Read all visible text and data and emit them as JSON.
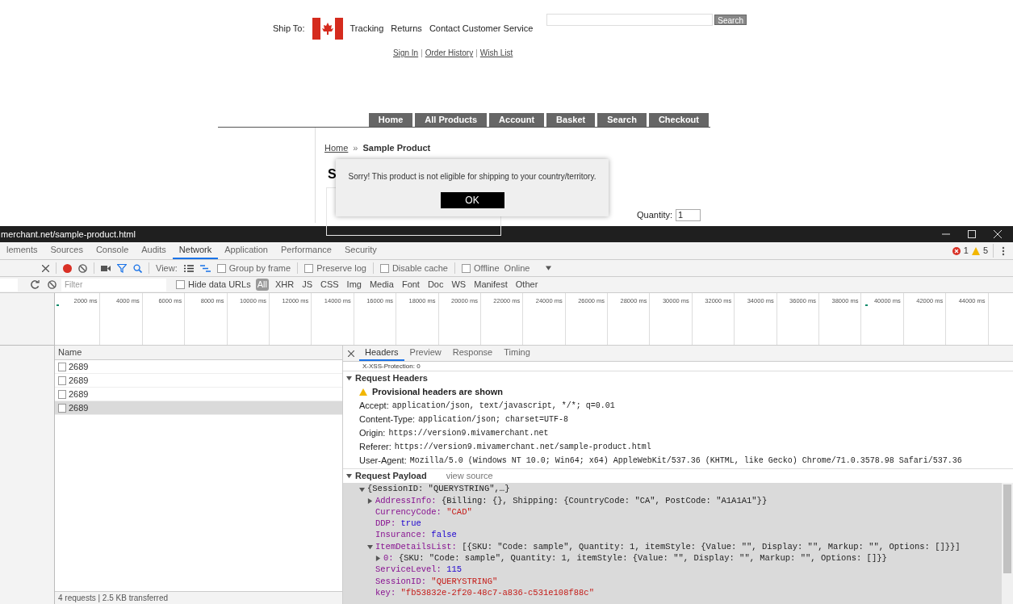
{
  "site": {
    "ship_to_label": "Ship To:",
    "top_links": [
      "Tracking",
      "Returns",
      "Contact Customer Service"
    ],
    "search_button": "Search",
    "account_links": [
      "Sign In",
      "Order History",
      "Wish List"
    ],
    "link_separator": "|",
    "nav": [
      "Home",
      "All Products",
      "Account",
      "Basket",
      "Search",
      "Checkout"
    ],
    "breadcrumb": {
      "link": "Home",
      "separator": "»",
      "current": "Sample Product"
    },
    "heading": "S",
    "quantity": {
      "label": "Quantity:",
      "value": "1"
    },
    "dialog": {
      "message": "Sorry! This product is not eligible for shipping to your country/territory.",
      "button": "OK"
    }
  },
  "devtools": {
    "url": "merchant.net/sample-product.html",
    "panel_tabs": [
      {
        "label": "lements",
        "selected": false
      },
      {
        "label": "Sources",
        "selected": false
      },
      {
        "label": "Console",
        "selected": false
      },
      {
        "label": "Audits",
        "selected": false
      },
      {
        "label": "Network",
        "selected": true
      },
      {
        "label": "Application",
        "selected": false
      },
      {
        "label": "Performance",
        "selected": false
      },
      {
        "label": "Security",
        "selected": false
      }
    ],
    "errors": "1",
    "warnings": "5",
    "toolbar": {
      "recording": true,
      "filter_active": true,
      "view_label": "View:",
      "options": [
        {
          "label": "Group by frame",
          "checked": false
        },
        {
          "label": "Preserve log",
          "checked": false
        },
        {
          "label": "Disable cache",
          "checked": false
        },
        {
          "label": "Offline",
          "checked": false
        }
      ],
      "throttle": "Online"
    },
    "filter_bar": {
      "placeholder": "Filter",
      "hide_data_urls": {
        "label": "Hide data URLs",
        "checked": false
      },
      "types": [
        {
          "label": "All",
          "selected": true
        },
        {
          "label": "XHR",
          "selected": false
        },
        {
          "label": "JS",
          "selected": false
        },
        {
          "label": "CSS",
          "selected": false
        },
        {
          "label": "Img",
          "selected": false
        },
        {
          "label": "Media",
          "selected": false
        },
        {
          "label": "Font",
          "selected": false
        },
        {
          "label": "Doc",
          "selected": false
        },
        {
          "label": "WS",
          "selected": false
        },
        {
          "label": "Manifest",
          "selected": false
        },
        {
          "label": "Other",
          "selected": false
        }
      ]
    },
    "timeline": {
      "ticks": [
        "2000 ms",
        "4000 ms",
        "6000 ms",
        "8000 ms",
        "10000 ms",
        "12000 ms",
        "14000 ms",
        "16000 ms",
        "18000 ms",
        "20000 ms",
        "22000 ms",
        "24000 ms",
        "26000 ms",
        "28000 ms",
        "30000 ms",
        "32000 ms",
        "34000 ms",
        "36000 ms",
        "38000 ms",
        "40000 ms",
        "42000 ms",
        "44000 ms"
      ]
    },
    "requests": {
      "column": "Name",
      "rows": [
        {
          "name": "2689",
          "selected": false
        },
        {
          "name": "2689",
          "selected": false
        },
        {
          "name": "2689",
          "selected": false
        },
        {
          "name": "2689",
          "selected": true
        }
      ],
      "summary": "4 requests | 2.5 KB transferred"
    },
    "detail_tabs": [
      {
        "label": "Headers",
        "selected": true
      },
      {
        "label": "Preview",
        "selected": false
      },
      {
        "label": "Response",
        "selected": false
      },
      {
        "label": "Timing",
        "selected": false
      }
    ],
    "cut_line": "X-XSS-Protection: 0",
    "request_headers": {
      "title": "Request Headers",
      "expanded": true,
      "notice": "Provisional headers are shown",
      "rows": [
        {
          "name": "Accept:",
          "value": "application/json, text/javascript, */*; q=0.01"
        },
        {
          "name": "Content-Type:",
          "value": "application/json; charset=UTF-8"
        },
        {
          "name": "Origin:",
          "value": "https://version9.mivamerchant.net"
        },
        {
          "name": "Referer:",
          "value": "https://version9.mivamerchant.net/sample-product.html"
        },
        {
          "name": "User-Agent:",
          "value": "Mozilla/5.0 (Windows NT 10.0; Win64; x64) AppleWebKit/537.36 (KHTML, like Gecko) Chrome/71.0.3578.98 Safari/537.36"
        }
      ]
    },
    "request_payload": {
      "title": "Request Payload",
      "expanded": true,
      "view_source": "view source",
      "tree": [
        {
          "value": "{SessionID: \"QUERYSTRING\",…}",
          "kind": "object",
          "expanded": true,
          "children": [
            {
              "key": "AddressInfo:",
              "value": "{Billing: {}, Shipping: {CountryCode: \"CA\", PostCode: \"A1A1A1\"}}",
              "kind": "object",
              "expanded": false
            },
            {
              "key": "CurrencyCode:",
              "value": "\"CAD\"",
              "kind": "string"
            },
            {
              "key": "DDP:",
              "value": "true",
              "kind": "keyword"
            },
            {
              "key": "Insurance:",
              "value": "false",
              "kind": "keyword"
            },
            {
              "key": "ItemDetailsList:",
              "value": "[{SKU: \"Code: sample\", Quantity: 1, itemStyle: {Value: \"\", Display: \"\", Markup: \"\", Options: []}}]",
              "kind": "object",
              "expanded": true,
              "children": [
                {
                  "key": "0:",
                  "value": "{SKU: \"Code: sample\", Quantity: 1, itemStyle: {Value: \"\", Display: \"\", Markup: \"\", Options: []}}",
                  "kind": "object",
                  "expanded": false
                }
              ]
            },
            {
              "key": "ServiceLevel:",
              "value": "115",
              "kind": "number"
            },
            {
              "key": "SessionID:",
              "value": "\"QUERYSTRING\"",
              "kind": "string"
            },
            {
              "key": "key:",
              "value": "\"fb53832e-2f20-48c7-a836-c531e108f88c\"",
              "kind": "string"
            }
          ]
        }
      ]
    }
  }
}
